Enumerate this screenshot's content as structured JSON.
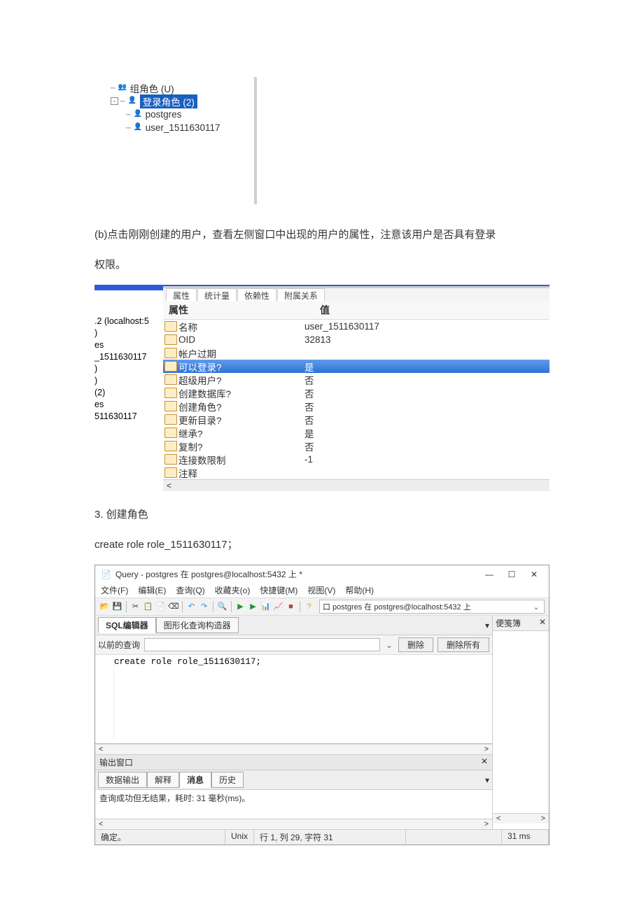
{
  "fig1": {
    "tree": {
      "group_roles": "组角色 (U)",
      "login_roles": "登录角色 (2)",
      "child1": "postgres",
      "child2": "user_1511630117"
    }
  },
  "text": {
    "p1": "(b)点击刚刚创建的用户，查看左侧窗口中出现的用户的属性，注意该用户是否具有登录",
    "p2": "权限。",
    "n3": "3.  创建角色",
    "cmd": "create role role_1511630117；"
  },
  "fig2": {
    "tabs": [
      "属性",
      "统计量",
      "依赖性",
      "附属关系"
    ],
    "header": {
      "prop": "属性",
      "val": "值"
    },
    "left": [
      ".2 (localhost:5",
      ")",
      "es",
      "_1511630117",
      ")",
      ")",
      "(2)",
      "es",
      "511630117"
    ],
    "rows": [
      {
        "n": "名称",
        "v": "user_1511630117"
      },
      {
        "n": "OID",
        "v": "32813"
      },
      {
        "n": "帐户过期",
        "v": ""
      },
      {
        "n": "可以登录?",
        "v": "是",
        "sel": true
      },
      {
        "n": "超级用户?",
        "v": "否"
      },
      {
        "n": "创建数据库?",
        "v": "否"
      },
      {
        "n": "创建角色?",
        "v": "否"
      },
      {
        "n": "更新目录?",
        "v": "否"
      },
      {
        "n": "继承?",
        "v": "是"
      },
      {
        "n": "复制?",
        "v": "否"
      },
      {
        "n": "连接数限制",
        "v": "-1"
      },
      {
        "n": "注释",
        "v": ""
      }
    ],
    "sbarrow": "<"
  },
  "fig3": {
    "title": "Query - postgres 在  postgres@localhost:5432 上 *",
    "menu": [
      "文件(F)",
      "编辑(E)",
      "查询(Q)",
      "收藏夹(o)",
      "快捷键(M)",
      "视图(V)",
      "帮助(H)"
    ],
    "conn": "口 postgres 在  postgres@localhost:5432 上",
    "tabs": {
      "sql": "SQL编辑器",
      "gfx": "图形化查询构造器"
    },
    "prev": {
      "label": "以前的查询",
      "del": "删除",
      "delall": "删除所有"
    },
    "code": "create role role_1511630117;",
    "side": {
      "scratch": "便笺簿",
      "close": "✕"
    },
    "out": {
      "title": "输出窗口",
      "tabs": [
        "数据输出",
        "解释",
        "消息",
        "历史"
      ],
      "msg": "查询成功但无结果，耗时: 31 毫秒(ms)。"
    },
    "status": {
      "ok": "确定。",
      "enc": "Unix",
      "pos": "行 1, 列 29, 字符 31",
      "time": "31 ms"
    }
  }
}
